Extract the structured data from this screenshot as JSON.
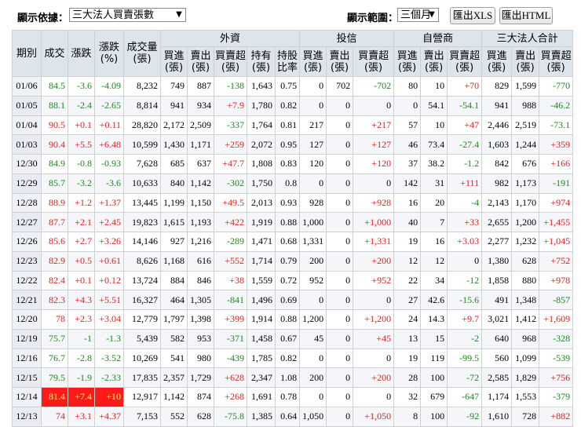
{
  "toolbar": {
    "display_by_label": "顯示依據：",
    "display_by_value": "三大法人買賣張數",
    "range_label": "顯示範圍：",
    "range_value": "三個月",
    "export_xls": "匯出XLS",
    "export_html": "匯出HTML"
  },
  "columns": {
    "date": "期別",
    "close": "成交",
    "change": "漲跌",
    "change_pct": "漲跌\n(%)",
    "volume": "成交量\n(張)",
    "foreign": "外資",
    "trust": "投信",
    "dealer": "自營商",
    "total": "三大法人合計",
    "buy": "買進\n(張)",
    "sell": "賣出\n(張)",
    "net": "買賣超\n(張)",
    "holding": "持有\n(張)",
    "holding_ratio": "持股\n比率"
  },
  "colors": {
    "up": "#e02020",
    "down": "#1a8a1a",
    "limit_up_bg": "#ff1a1a"
  },
  "rows": [
    [
      "01/06",
      "84.5",
      "-3.6",
      "-4.09",
      "8,232",
      "749",
      "887",
      "-138",
      "1,643",
      "0.75",
      "0",
      "702",
      "-702",
      "80",
      "10",
      "+70",
      "829",
      "1,599",
      "-770"
    ],
    [
      "01/05",
      "88.1",
      "-2.4",
      "-2.65",
      "8,814",
      "941",
      "934",
      "+7.9",
      "1,780",
      "0.82",
      "0",
      "0",
      "0",
      "0",
      "54.1",
      "-54.1",
      "941",
      "988",
      "-46.2"
    ],
    [
      "01/04",
      "90.5",
      "+0.1",
      "+0.11",
      "28,820",
      "2,172",
      "2,509",
      "-337",
      "1,764",
      "0.81",
      "217",
      "0",
      "+217",
      "57",
      "10",
      "+47",
      "2,446",
      "2,519",
      "-73.1"
    ],
    [
      "01/03",
      "90.4",
      "+5.5",
      "+6.48",
      "10,599",
      "1,430",
      "1,171",
      "+259",
      "2,072",
      "0.95",
      "127",
      "0",
      "+127",
      "46",
      "73.4",
      "-27.4",
      "1,603",
      "1,244",
      "+359"
    ],
    [
      "12/30",
      "84.9",
      "-0.8",
      "-0.93",
      "7,628",
      "685",
      "637",
      "+47.7",
      "1,808",
      "0.83",
      "120",
      "0",
      "+120",
      "37",
      "38.2",
      "-1.2",
      "842",
      "676",
      "+166"
    ],
    [
      "12/29",
      "85.7",
      "-3.2",
      "-3.6",
      "10,633",
      "840",
      "1,142",
      "-302",
      "1,750",
      "0.8",
      "0",
      "0",
      "0",
      "142",
      "31",
      "+111",
      "982",
      "1,173",
      "-191"
    ],
    [
      "12/28",
      "88.9",
      "+1.2",
      "+1.37",
      "13,445",
      "1,199",
      "1,150",
      "+49.5",
      "2,013",
      "0.93",
      "928",
      "0",
      "+928",
      "16",
      "20",
      "-4",
      "2,143",
      "1,170",
      "+974"
    ],
    [
      "12/27",
      "87.7",
      "+2.1",
      "+2.45",
      "19,823",
      "1,615",
      "1,193",
      "+422",
      "1,919",
      "0.88",
      "1,000",
      "0",
      "+1,000",
      "40",
      "7",
      "+33",
      "2,655",
      "1,200",
      "+1,455"
    ],
    [
      "12/26",
      "85.6",
      "+2.7",
      "+3.26",
      "14,146",
      "927",
      "1,216",
      "-289",
      "1,471",
      "0.68",
      "1,331",
      "0",
      "+1,331",
      "19",
      "16",
      "+3.03",
      "2,277",
      "1,232",
      "+1,045"
    ],
    [
      "12/23",
      "82.9",
      "+0.5",
      "+0.61",
      "8,626",
      "1,168",
      "616",
      "+552",
      "1,714",
      "0.79",
      "200",
      "0",
      "+200",
      "12",
      "12",
      "0",
      "1,380",
      "628",
      "+752"
    ],
    [
      "12/22",
      "82.4",
      "+0.1",
      "+0.12",
      "13,724",
      "884",
      "846",
      "+38",
      "1,559",
      "0.72",
      "952",
      "0",
      "+952",
      "22",
      "34",
      "-12",
      "1,858",
      "880",
      "+978"
    ],
    [
      "12/21",
      "82.3",
      "+4.3",
      "+5.51",
      "16,327",
      "464",
      "1,305",
      "-841",
      "1,496",
      "0.69",
      "0",
      "0",
      "0",
      "27",
      "42.6",
      "-15.6",
      "491",
      "1,348",
      "-857"
    ],
    [
      "12/20",
      "78",
      "+2.3",
      "+3.04",
      "12,779",
      "1,797",
      "1,398",
      "+399",
      "1,914",
      "0.88",
      "1,200",
      "0",
      "+1,200",
      "24",
      "14.3",
      "+9.7",
      "3,021",
      "1,412",
      "+1,609"
    ],
    [
      "12/19",
      "75.7",
      "-1",
      "-1.3",
      "5,439",
      "582",
      "953",
      "-371",
      "1,458",
      "0.67",
      "45",
      "0",
      "+45",
      "13",
      "15",
      "-2",
      "640",
      "968",
      "-328"
    ],
    [
      "12/16",
      "76.7",
      "-2.8",
      "-3.52",
      "10,269",
      "541",
      "980",
      "-439",
      "1,785",
      "0.82",
      "0",
      "0",
      "0",
      "19",
      "119",
      "-99.5",
      "560",
      "1,099",
      "-539"
    ],
    [
      "12/15",
      "79.5",
      "-1.9",
      "-2.33",
      "17,835",
      "2,357",
      "1,729",
      "+628",
      "2,347",
      "1.08",
      "200",
      "0",
      "+200",
      "28",
      "100",
      "-72",
      "2,585",
      "1,829",
      "+756"
    ],
    [
      "12/14",
      "81.4",
      "+7.4",
      "+10",
      "12,917",
      "1,142",
      "874",
      "+268",
      "1,691",
      "0.78",
      "0",
      "0",
      "0",
      "32",
      "679",
      "-647",
      "1,174",
      "1,553",
      "-379"
    ],
    [
      "12/13",
      "74",
      "+3.1",
      "+4.37",
      "7,153",
      "552",
      "628",
      "-75.8",
      "1,385",
      "0.64",
      "1,050",
      "0",
      "+1,050",
      "8",
      "100",
      "-92",
      "1,610",
      "728",
      "+882"
    ]
  ],
  "limit_up_date": "12/14"
}
